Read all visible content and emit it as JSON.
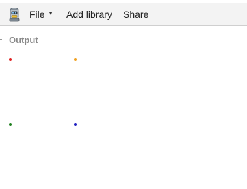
{
  "toolbar": {
    "logo_icon": "robot-logo-icon",
    "file_label": "File",
    "file_caret_icon": "caret-down-icon",
    "add_library_label": "Add library",
    "share_label": "Share"
  },
  "output": {
    "label": "Output",
    "points": [
      {
        "name": "red-point",
        "color": "#e02020"
      },
      {
        "name": "orange-point",
        "color": "#f0a020"
      },
      {
        "name": "green-point",
        "color": "#208020"
      },
      {
        "name": "blue-point",
        "color": "#2020c0"
      }
    ]
  }
}
